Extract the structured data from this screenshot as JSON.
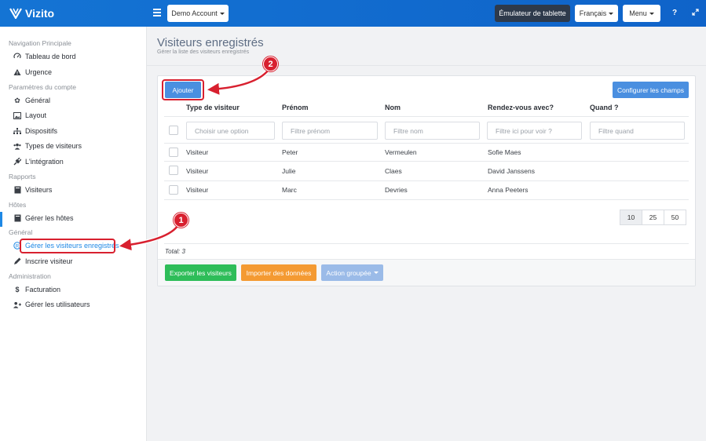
{
  "app": {
    "brand": "Vizito"
  },
  "topbar": {
    "account": "Demo Account",
    "tablet_emulator": "Émulateur de tablette",
    "language": "Français",
    "menu": "Menu",
    "help_icon": "question-icon",
    "fullscreen_icon": "expand-icon"
  },
  "sidebar": {
    "sections": [
      {
        "title": "Navigation Principale",
        "items": [
          {
            "label": "Tableau de bord",
            "icon": "dashboard-icon"
          },
          {
            "label": "Urgence",
            "icon": "warning-icon"
          }
        ]
      },
      {
        "title": "Paramètres du compte",
        "items": [
          {
            "label": "Général",
            "icon": "gear-icon"
          },
          {
            "label": "Layout",
            "icon": "image-icon"
          },
          {
            "label": "Dispositifs",
            "icon": "sitemap-icon"
          },
          {
            "label": "Types de visiteurs",
            "icon": "users-icon"
          },
          {
            "label": "L'intégration",
            "icon": "plug-icon"
          }
        ]
      },
      {
        "title": "Rapports",
        "items": [
          {
            "label": "Visiteurs",
            "icon": "book-icon"
          }
        ]
      },
      {
        "title": "Hôtes",
        "items": [
          {
            "label": "Gérer les hôtes",
            "icon": "book-icon"
          }
        ]
      },
      {
        "title": "Général",
        "items": [
          {
            "label": "Gérer les visiteurs enregistrés",
            "icon": "registered-icon",
            "active": true
          },
          {
            "label": "Inscrire visiteur",
            "icon": "pencil-icon"
          }
        ]
      },
      {
        "title": "Administration",
        "items": [
          {
            "label": "Facturation",
            "icon": "dollar-icon"
          },
          {
            "label": "Gérer les utilisateurs",
            "icon": "user-plus-icon"
          }
        ]
      }
    ]
  },
  "page": {
    "title": "Visiteurs enregistrés",
    "subtitle": "Gérer la liste des visiteurs enregistrés"
  },
  "toolbar": {
    "add": "Ajouter",
    "configure": "Configurer les champs"
  },
  "table": {
    "columns": [
      "Type de visiteur",
      "Prénom",
      "Nom",
      "Rendez-vous avec?",
      "Quand ?"
    ],
    "filters": [
      "Choisir une option",
      "Filtre prénom",
      "Filtre nom",
      "Filtre ici pour voir ?",
      "Filtre quand"
    ],
    "rows": [
      [
        "Visiteur",
        "Peter",
        "Vermeulen",
        "Sofie Maes",
        ""
      ],
      [
        "Visiteur",
        "Julie",
        "Claes",
        "David Janssens",
        ""
      ],
      [
        "Visiteur",
        "Marc",
        "Devries",
        "Anna Peeters",
        ""
      ]
    ]
  },
  "pagination": {
    "sizes": [
      "10",
      "25",
      "50"
    ],
    "selected": "10"
  },
  "total": "Total: 3",
  "actions": {
    "export": "Exporter les visiteurs",
    "import": "Importer des données",
    "bulk": "Action groupée"
  },
  "callouts": [
    "1",
    "2"
  ],
  "colors": {
    "brand": "#1474d4",
    "accent": "#4a8fe0",
    "export": "#2ebd59",
    "import": "#f49a32",
    "bulk": "#9bbbe8",
    "callout": "#d8202f"
  }
}
